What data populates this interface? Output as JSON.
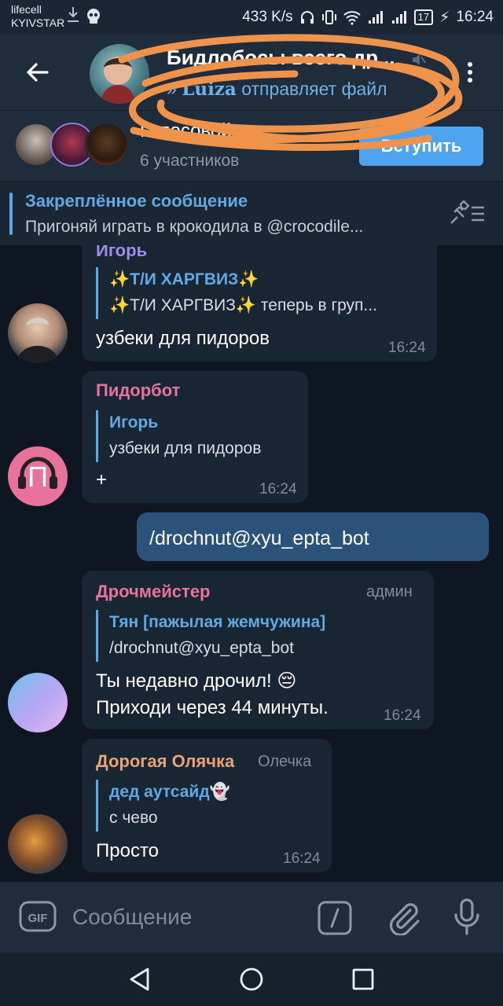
{
  "status_bar": {
    "carrier_line1": "lifecell",
    "carrier_line2": "KYIVSTAR",
    "net_speed": "433 K/s",
    "battery": "17",
    "time": "16:24"
  },
  "header": {
    "title": "Бидлобосы всего др...",
    "status_name": "Luiza",
    "status_action": "отправляет файл"
  },
  "join_bar": {
    "title": "Голосовой чат",
    "subtitle": "6 участников",
    "join_label": "Вступить"
  },
  "pinned": {
    "title": "Закреплённое сообщение",
    "text": "Пригоняй играть в крокодила в @crocodile..."
  },
  "messages": [
    {
      "sender": "Игорь",
      "reply_name": "✨Т/И ХАРГВИЗ✨",
      "reply_text": "✨Т/И ХАРГВИЗ✨ теперь в груп...",
      "text": "узбеки для пидоров",
      "time": "16:24"
    },
    {
      "sender": "Пидорбот",
      "avatar_letter": "П",
      "reply_name": "Игорь",
      "reply_text": "узбеки для пидоров",
      "text": "+",
      "time": "16:24"
    },
    {
      "outgoing": true,
      "text": "/drochnut@xyu_epta_bot"
    },
    {
      "sender": "Дрочмейстер",
      "role": "админ",
      "reply_name": "Тян [пажылая жемчужина]",
      "reply_text": "/drochnut@xyu_epta_bot",
      "text_line1": "Ты недавно дрочил! 😔",
      "text_line2": "Приходи через 44 минуты.",
      "time": "16:24"
    },
    {
      "sender": "Дорогая Олячка",
      "role": "Олечка",
      "reply_name": "дед аутсайд👻",
      "reply_text": "с чево",
      "text": "Просто",
      "time": "16:24"
    }
  ],
  "input": {
    "placeholder": "Сообщение"
  },
  "colors": {
    "background": "#0e1621",
    "header": "#1f2c3b",
    "incoming_bubble": "#182533",
    "outgoing_bubble": "#2b5278",
    "accent": "#62a9e4",
    "sender_igor": "#9c8ee8",
    "sender_pidorbot": "#e8729c",
    "sender_drochmeister": "#e8729c",
    "sender_olyachka": "#e8a276"
  }
}
